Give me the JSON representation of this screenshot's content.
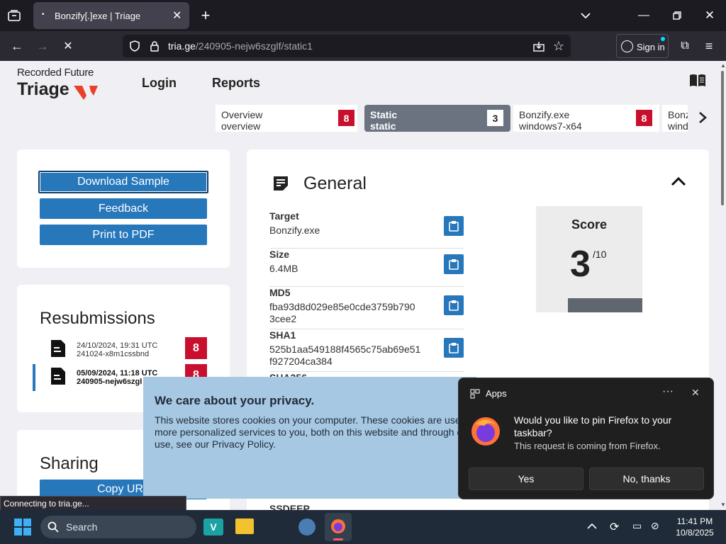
{
  "browser": {
    "tab_title": "Bonzify[.]exe | Triage",
    "url_domain": "tria.ge",
    "url_path": "/240905-nejw6szglf/static1",
    "sign_in": "Sign in",
    "status": "Connecting to tria.ge..."
  },
  "site": {
    "brand_top": "Recorded Future",
    "brand_bottom": "Triage",
    "nav": [
      "Login",
      "Reports"
    ]
  },
  "tabs": [
    {
      "line1": "Overview",
      "line2": "overview",
      "count": "8",
      "active": false
    },
    {
      "line1": "Static",
      "line2": "static",
      "count": "3",
      "active": true
    },
    {
      "line1": "Bonzify.exe",
      "line2": "windows7-x64",
      "count": "8",
      "active": false
    },
    {
      "line1": "Bonz",
      "line2": "wind",
      "count": "",
      "active": false
    }
  ],
  "actions": {
    "download": "Download Sample",
    "feedback": "Feedback",
    "print": "Print to PDF"
  },
  "resubmissions": {
    "title": "Resubmissions",
    "items": [
      {
        "date": "24/10/2024, 19:31 UTC",
        "id": "241024-x8m1cssbnd",
        "score": "8"
      },
      {
        "date": "05/09/2024, 11:18 UTC",
        "id": "240905-nejw6szgl",
        "score": "8"
      }
    ]
  },
  "sharing": {
    "title": "Sharing",
    "copy_url": "Copy URL"
  },
  "general": {
    "title": "General",
    "fields": [
      {
        "label": "Target",
        "value": "Bonzify.exe"
      },
      {
        "label": "Size",
        "value": "6.4MB"
      },
      {
        "label": "MD5",
        "value": "fba93d8d029e85e0cde3759b790\n3cee2"
      },
      {
        "label": "SHA1",
        "value": "525b1aa549188f4565c75ab69e51\nf927204ca384"
      },
      {
        "label": "SHA256",
        "value": ""
      }
    ],
    "ssdeep_label": "SSDEEP",
    "score_title": "Score",
    "score_value": "3",
    "score_max": "/10",
    "score_fraction": 0.3
  },
  "cookie": {
    "title": "We care about your privacy.",
    "text": "This website stores cookies on your computer. These cookies are used to improve your website experience and provide more personalized services to you, both on this website and through other media. To find out more about the cookies we use, see our Privacy Policy."
  },
  "popup": {
    "app_label": "Apps",
    "question": "Would you like to pin Firefox to your taskbar?",
    "sub": "This request is coming from Firefox.",
    "yes": "Yes",
    "no": "No, thanks"
  },
  "taskbar": {
    "search": "Search",
    "time": "11:41 PM",
    "date": "10/8/2025"
  }
}
